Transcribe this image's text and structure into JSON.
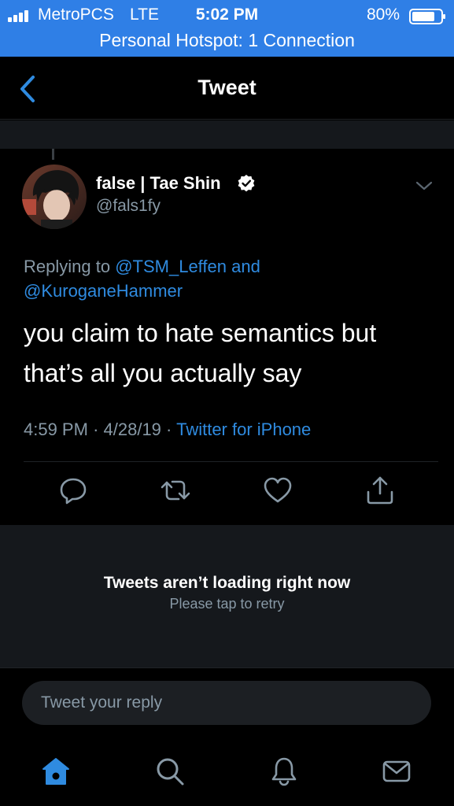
{
  "status_bar": {
    "carrier": "MetroPCS",
    "network": "LTE",
    "time": "5:02 PM",
    "battery_percent": "80%",
    "battery_level": 0.8,
    "hotspot": "Personal Hotspot: 1 Connection"
  },
  "nav": {
    "back_icon": "chevron-left-icon",
    "title": "Tweet"
  },
  "tweet": {
    "author": {
      "display_name": "false | Tae Shin",
      "handle": "@fals1fy",
      "verified": true
    },
    "replying_prefix": "Replying to",
    "reply_to_1": "@TSM_Leffen",
    "reply_joiner": "and",
    "reply_to_2": "@KuroganeHammer",
    "text_line_1": "you claim to hate semantics but",
    "text_line_2": "that’s all you actually say",
    "time": "4:59 PM",
    "separator": "·",
    "date": "4/28/19",
    "source": "Twitter for iPhone",
    "actions": [
      "reply-icon",
      "retweet-icon",
      "like-icon",
      "share-icon"
    ]
  },
  "loading": {
    "title": "Tweets aren’t loading right now",
    "subtitle": "Please tap to retry"
  },
  "reply_bar": {
    "placeholder": "Tweet your reply"
  },
  "tab_bar": {
    "tabs": [
      "home-icon",
      "search-icon",
      "notifications-icon",
      "messages-icon"
    ],
    "active": "home-icon"
  },
  "colors": {
    "accent": "#2f8be0",
    "status_bar": "#2f7fe6",
    "background": "#000000",
    "muted_text": "#8899a6",
    "panel": "#15181c"
  }
}
